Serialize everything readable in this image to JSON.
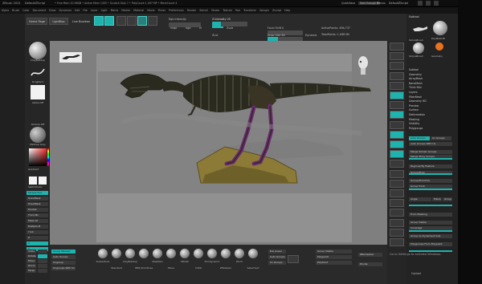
{
  "titlebar": {
    "app_title": "ZBrush 2022",
    "doc_title": "DefaultZScript",
    "info": "• Free Mem 20.96GB • Active Mem 1405 • Scratch Disk 7 • PolyCount 1.097 MP • MeshCount 4",
    "quicksave": "QuickSave",
    "see_through": "See-through 0",
    "menus": "Menus",
    "default_zscript": "DefaultZScript"
  },
  "menubar": [
    "Alpha",
    "Brush",
    "Color",
    "Document",
    "Draw",
    "Dynamics",
    "Edit",
    "File",
    "Layer",
    "Light",
    "Macro",
    "Marker",
    "Material",
    "Movie",
    "Picker",
    "Preferences",
    "Render",
    "Stencil",
    "Stroke",
    "Texture",
    "Tool",
    "Transform",
    "Zplugin",
    "Zscript",
    "Help"
  ],
  "topbar": {
    "home_tab": "Home Page",
    "lightbox": "LightBox",
    "live_boolean": "Live Boolean",
    "edit": "Edit",
    "draw": "Draw",
    "move": "Move",
    "scale": "Scale",
    "rotate": "Rotate",
    "mrgb": "Mrgb",
    "rgb": "Rgb",
    "m": "M",
    "zadd": "Zadd",
    "zsub": "Zsub",
    "zcut": "Zcut",
    "rgb_intensity": "Rgb Intensity",
    "z_intensity": "Z Intensity 25",
    "focal_shift": "Focal Shift 0",
    "draw_size": "Draw Size 64",
    "dynamic": "Dynamic",
    "active_points": "ActivePoints: 496,737",
    "total_points": "TotalPoints: 1.098 Mil",
    "z_intensity_value": 0.25,
    "draw_size_value": 0.3
  },
  "leftshelf": {
    "brush_label": "ClayBuildup",
    "stroke_label": "DragRect",
    "alpha_label": "Alpha Off",
    "texture_label": "Texture Off",
    "material_label": "MatCap Gray",
    "gradient": "Gradient",
    "switch_color": "SwitchColor",
    "alternate": "Alternate",
    "buttons": [
      "Perspective",
      "DrawMask",
      "DrawMask",
      "Double",
      "Third Mn",
      "Mask LP",
      "Multiple B",
      "Yroll",
      "Z",
      "X",
      "Y"
    ],
    "bottom_buttons": [
      "Scale",
      "Rotate",
      "Move",
      "Zoom",
      "Persp"
    ]
  },
  "canvas": {
    "accent": "#1fb3ae",
    "model_colors": {
      "skeleton": "#2b2a1f",
      "base": "#8c7a37",
      "legs": "#6d2a72"
    }
  },
  "rightshelf": [
    "BPR",
    "Spix 3",
    "Scroll",
    "Zoom",
    "Actual",
    "AAHalf",
    "Dynamic",
    "Persp",
    "Floor",
    "Local",
    "L.Sym",
    "Frame",
    "Move",
    "Scale",
    "Rotate",
    "Line Fill",
    "PolyF",
    "Transp",
    "Ghost",
    "Solo",
    "Xpose"
  ],
  "rightpanel": {
    "header": "Subtool",
    "tool_labels": [
      "SimpleBrush",
      "PolyMesh3D",
      "SimpleBrush",
      "Geometry"
    ],
    "palette_items": [
      "Subtool",
      "Geometry",
      "ArrayMesh",
      "NanoMesh",
      "Thick Skin",
      "Layers",
      "FiberMesh",
      "Geometry HD",
      "Preview",
      "Surface",
      "Deformation",
      "Masking",
      "Visibility",
      "Polygroups"
    ],
    "buttons": [
      "Auto Groups",
      "Uv Groups",
      "Auto Groups With Uv",
      "Merge Similar Groups",
      "Merge Stray Groups",
      "Regroup By Feature",
      "GroupsFlow",
      "GroupsFromUVs",
      "Group Front",
      "Angle",
      "Polish",
      "Group Masked",
      "From Masking",
      "Group Visible",
      "Coverage",
      "Group As Dynamesh Sub",
      "Polygroups From Polypaint"
    ],
    "bottom_label": "Contact"
  },
  "bottombar": {
    "group_masked": "Group Masked",
    "brushes": [
      "SnakeHook",
      "Standard",
      "ClayBuildup",
      "IMM_Primitives",
      "MaskPen",
      "Move",
      "hPolish",
      "Inflat",
      "Trimdynamic",
      "ZModeler",
      "Pinch",
      "Selectrect"
    ],
    "mid_labels": [
      "Auto Groups",
      "Ungroup",
      "Ungroups With Uv",
      "Group Visible",
      "Polypaint",
      "Polyfaint"
    ],
    "right_buttons": [
      "ZRemesher",
      "Divide",
      "Del Lower",
      "Auto Groups",
      "Uv Groups"
    ]
  },
  "watermark": "Go to Settings to activate Windows."
}
